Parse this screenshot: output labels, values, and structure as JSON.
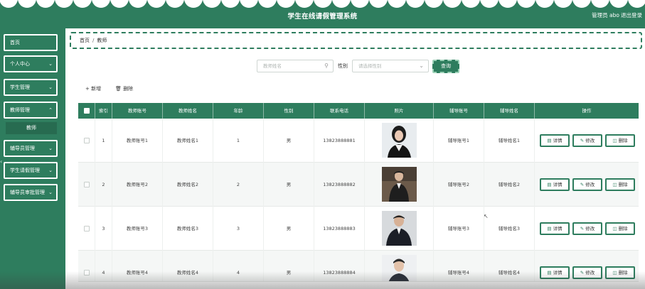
{
  "header": {
    "title": "学生在线请假管理系统",
    "user": "管理员 abo",
    "logout": "退出登录"
  },
  "sidebar": {
    "items": [
      {
        "label": "首页",
        "chevron": false
      },
      {
        "label": "个人中心",
        "chevron": true
      },
      {
        "label": "学生管理",
        "chevron": true
      },
      {
        "label": "教师管理",
        "chevron": true
      },
      {
        "label": "辅导员管理",
        "chevron": true
      },
      {
        "label": "学生请假管理",
        "chevron": true
      },
      {
        "label": "辅导员审批管理",
        "chevron": true
      }
    ],
    "submenu": "教师"
  },
  "breadcrumb": {
    "home": "首页",
    "separator": "/",
    "current": "教师"
  },
  "search": {
    "name_placeholder": "教师姓名",
    "gender_label": "性别",
    "gender_placeholder": "请选择性别",
    "query_label": "查询"
  },
  "actions": {
    "add": "新增",
    "delete": "删除"
  },
  "table": {
    "columns": [
      "索引",
      "教师账号",
      "教师姓名",
      "年龄",
      "性别",
      "联系电话",
      "照片",
      "辅导账号",
      "辅导姓名",
      "操作"
    ],
    "rows": [
      {
        "index": "1",
        "account": "教师账号1",
        "name": "教师姓名1",
        "age": "1",
        "gender": "男",
        "phone": "13823888881",
        "tutor_account": "辅导账号1",
        "tutor_name": "辅导姓名1"
      },
      {
        "index": "2",
        "account": "教师账号2",
        "name": "教师姓名2",
        "age": "2",
        "gender": "男",
        "phone": "13823888882",
        "tutor_account": "辅导账号2",
        "tutor_name": "辅导姓名2"
      },
      {
        "index": "3",
        "account": "教师账号3",
        "name": "教师姓名3",
        "age": "3",
        "gender": "男",
        "phone": "13823888883",
        "tutor_account": "辅导账号3",
        "tutor_name": "辅导姓名3"
      },
      {
        "index": "4",
        "account": "教师账号4",
        "name": "教师姓名4",
        "age": "4",
        "gender": "男",
        "phone": "13823888884",
        "tutor_account": "辅导账号4",
        "tutor_name": "辅导姓名4"
      }
    ],
    "op_labels": {
      "detail": "详情",
      "edit": "修改",
      "delete": "删除"
    }
  },
  "colors": {
    "primary": "#2e7d5e",
    "header_bg": "#2e7d5e",
    "sidebar_bg": "#2e7d5e"
  },
  "icons": {
    "search": "search-icon",
    "chevron": "chevron-down-icon",
    "add": "plus-icon",
    "delete": "trash-icon",
    "detail": "document-icon",
    "edit": "pencil-icon"
  }
}
